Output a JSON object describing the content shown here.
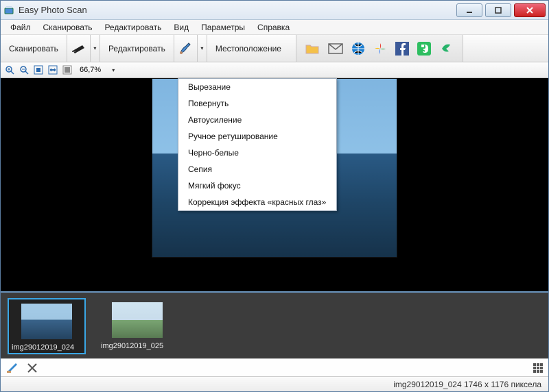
{
  "window": {
    "title": "Easy Photo Scan"
  },
  "menu": {
    "file": "Файл",
    "scan": "Сканировать",
    "edit": "Редактировать",
    "view": "Вид",
    "params": "Параметры",
    "help": "Справка"
  },
  "toolbar": {
    "scan_label": "Сканировать",
    "edit_label": "Редактировать",
    "location_label": "Местоположение"
  },
  "zoom": {
    "value": "66,7%"
  },
  "edit_menu": {
    "items": [
      "Вырезание",
      "Повернуть",
      "Автоусиление",
      "Ручное ретуширование",
      "Черно-белые",
      "Сепия",
      "Мягкий фокус",
      "Коррекция эффекта «красных глаз»"
    ]
  },
  "thumbnails": [
    {
      "name": "img29012019_024",
      "selected": true
    },
    {
      "name": "img29012019_025",
      "selected": false
    }
  ],
  "status": {
    "text": "img29012019_024 1746 x 1176 пиксела"
  }
}
